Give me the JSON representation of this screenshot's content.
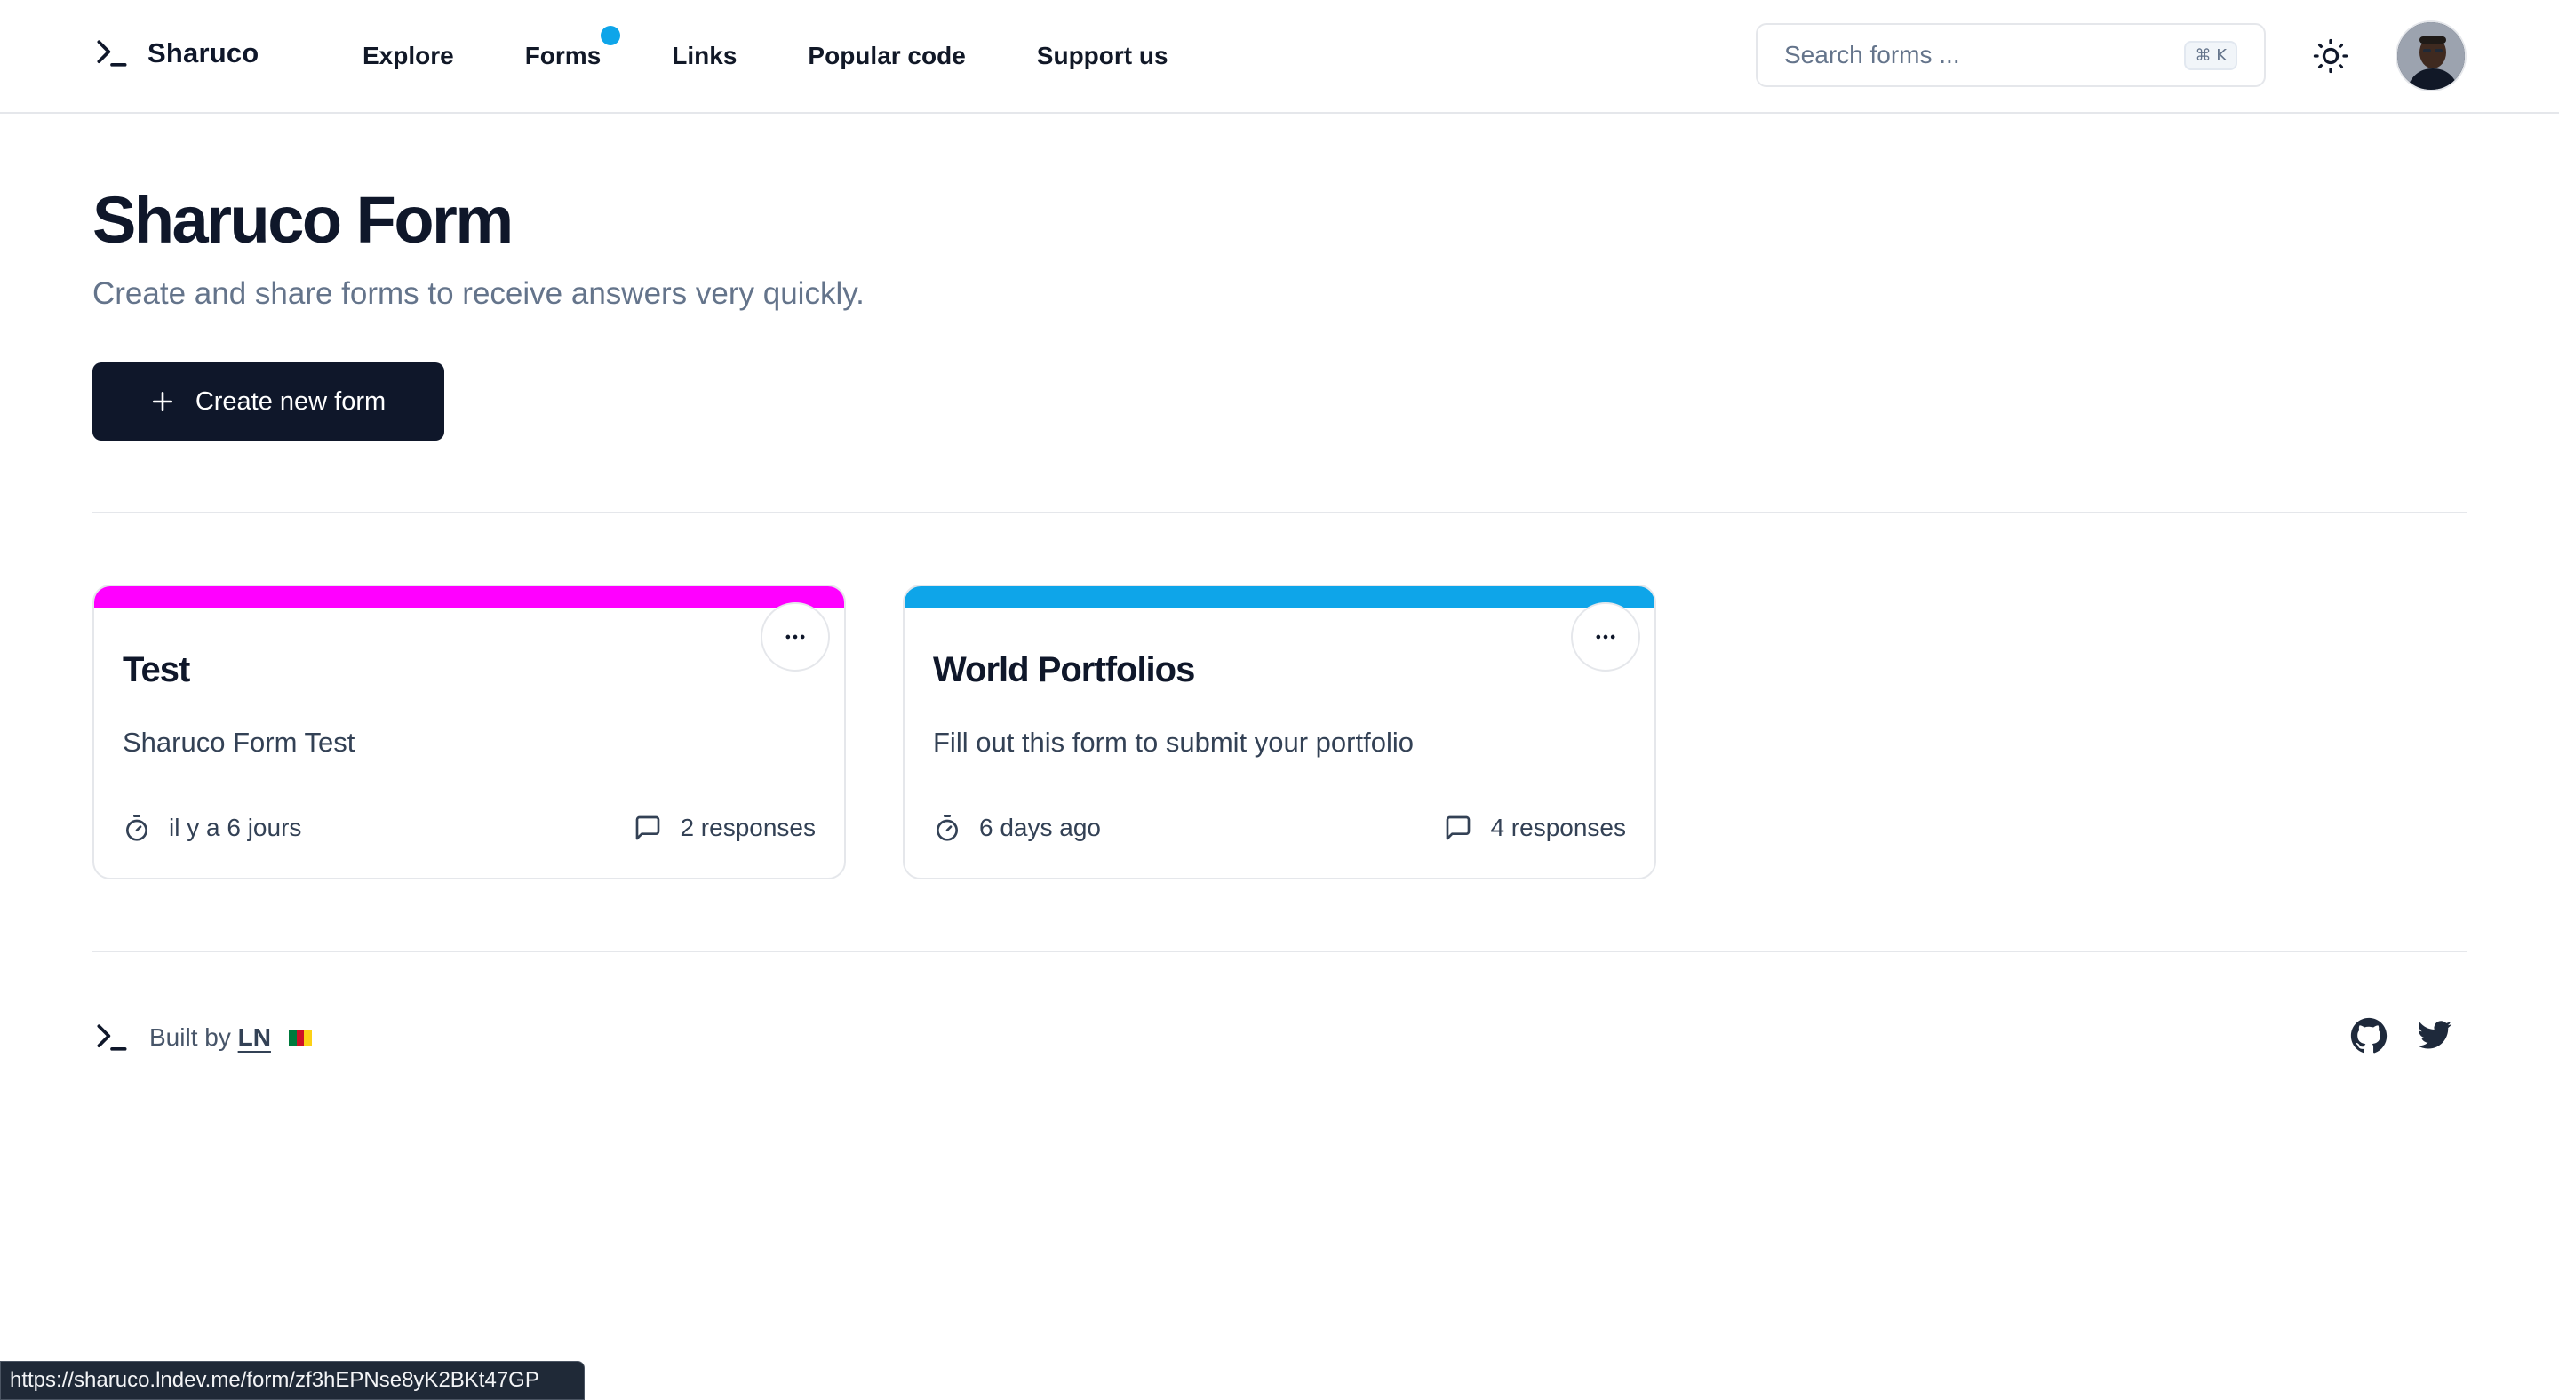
{
  "app": {
    "name": "Sharuco"
  },
  "nav": {
    "items": [
      {
        "label": "Explore"
      },
      {
        "label": "Forms",
        "has_notification": true
      },
      {
        "label": "Links"
      },
      {
        "label": "Popular code"
      },
      {
        "label": "Support us"
      }
    ]
  },
  "search": {
    "placeholder": "Search forms ...",
    "shortcut": "⌘ K"
  },
  "hero": {
    "title": "Sharuco Form",
    "subtitle": "Create and share forms to receive answers very quickly.",
    "create_button": "Create new form"
  },
  "forms": [
    {
      "title": "Test",
      "description": "Sharuco Form Test",
      "time": "il y a 6 jours",
      "responses": "2 responses",
      "color": "#ff00ff"
    },
    {
      "title": "World Portfolios",
      "description": "Fill out this form to submit your portfolio",
      "time": "6 days ago",
      "responses": "4 responses",
      "color": "#0ea5e9"
    }
  ],
  "footer": {
    "built_by": "Built by",
    "author": "LN"
  },
  "status_url": "https://sharuco.lndev.me/form/zf3hEPNse8yK2BKt47GP",
  "colors": {
    "primary": "#0f172a",
    "accent": "#0ea5e9",
    "magenta": "#ff00ff"
  }
}
